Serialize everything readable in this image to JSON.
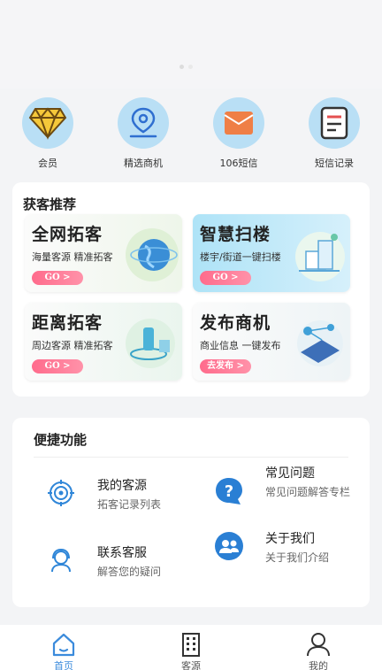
{
  "banner": {
    "dots": 2
  },
  "shortcuts": [
    {
      "label": "会员",
      "icon": "diamond-icon"
    },
    {
      "label": "精选商机",
      "icon": "location-pin-icon"
    },
    {
      "label": "106短信",
      "icon": "envelope-icon"
    },
    {
      "label": "短信记录",
      "icon": "record-list-icon"
    }
  ],
  "recommend": {
    "title": "获客推荐",
    "tiles": [
      {
        "title": "全网拓客",
        "subtitle": "海量客源 精准拓客",
        "button": "GO >",
        "icon": "globe-icon"
      },
      {
        "title": "智慧扫楼",
        "subtitle": "楼宇/街道一键扫楼",
        "button": "GO >",
        "icon": "building-scan-icon"
      },
      {
        "title": "距离拓客",
        "subtitle": "周边客源 精准拓客",
        "button": "GO >",
        "icon": "radar-distance-icon"
      },
      {
        "title": "发布商机",
        "subtitle": "商业信息 一键发布",
        "button": "去发布 >",
        "icon": "publish-network-icon"
      }
    ]
  },
  "quick": {
    "title": "便捷功能",
    "items": [
      {
        "label": "我的客源",
        "desc": "拓客记录列表",
        "icon": "target-icon"
      },
      {
        "label": "常见问题",
        "desc": "常见问题解答专栏",
        "icon": "question-bubble-icon"
      },
      {
        "label": "联系客服",
        "desc": "解答您的疑问",
        "icon": "customer-service-icon"
      },
      {
        "label": "关于我们",
        "desc": "关于我们介绍",
        "icon": "team-icon"
      }
    ]
  },
  "tabbar": [
    {
      "label": "首页",
      "icon": "home-icon",
      "active": true
    },
    {
      "label": "客源",
      "icon": "building-icon",
      "active": false
    },
    {
      "label": "我的",
      "icon": "user-icon",
      "active": false
    }
  ],
  "colors": {
    "accent": "#3b8bdc",
    "go_button": "#ff6b8c",
    "icon_circle": "#b9dff5"
  }
}
